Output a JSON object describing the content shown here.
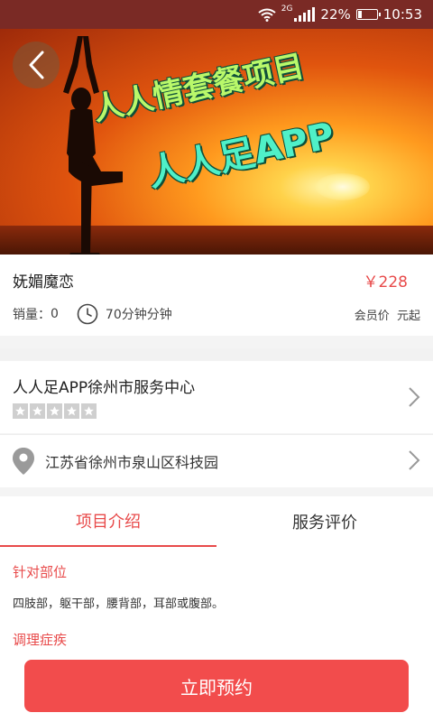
{
  "status_bar": {
    "network_tag": "2G",
    "battery": "22%",
    "battery_level": 0.22,
    "time": "10:53"
  },
  "hero": {
    "line1": "人人情套餐项目",
    "line2": "人人足APP"
  },
  "product": {
    "name": "妩媚魔恋",
    "price": "￥228",
    "sales_label": "销量：",
    "sales_value": "0",
    "duration": "70分钟分钟",
    "member_price": "会员价",
    "price_suffix": "元起"
  },
  "store": {
    "name": "人人足APP徐州市服务中心",
    "rating": 0,
    "rating_max": 5,
    "address": "江苏省徐州市泉山区科技园"
  },
  "tabs": [
    {
      "label": "项目介绍",
      "active": true
    },
    {
      "label": "服务评价",
      "active": false
    }
  ],
  "details": {
    "target_heading": "针对部位",
    "target_text": "四肢部，躯干部，腰背部，耳部或腹部。",
    "condition_heading": "调理症疾"
  },
  "actions": {
    "book_label": "立即预约"
  },
  "colors": {
    "accent": "#e84a4a",
    "status_bar": "#7a2a25",
    "button": "#f24c4c"
  }
}
